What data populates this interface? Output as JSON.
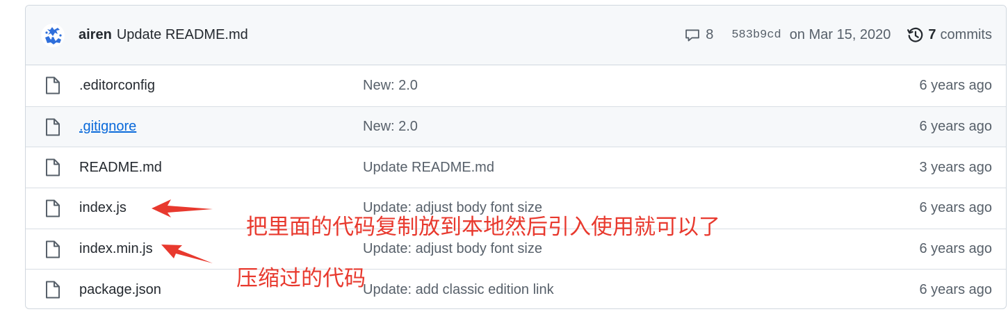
{
  "commit_bar": {
    "author": "airen",
    "message": "Update README.md",
    "comments_count": "8",
    "sha": "583b9cd",
    "date": "on Mar 15, 2020",
    "commits_count": "7",
    "commits_label": "commits"
  },
  "files": [
    {
      "name": ".editorconfig",
      "commit": "New: 2.0",
      "age": "6 years ago"
    },
    {
      "name": ".gitignore",
      "commit": "New: 2.0",
      "age": "6 years ago"
    },
    {
      "name": "README.md",
      "commit": "Update README.md",
      "age": "3 years ago"
    },
    {
      "name": "index.js",
      "commit": "Update: adjust body font size",
      "age": "6 years ago"
    },
    {
      "name": "index.min.js",
      "commit": "Update: adjust body font size",
      "age": "6 years ago"
    },
    {
      "name": "package.json",
      "commit": "Update: add classic edition link",
      "age": "6 years ago"
    }
  ],
  "annotations": {
    "copy_note": "把里面的代码复制放到本地然后引入使用就可以了",
    "minified_note": "压缩过的代码"
  },
  "colors": {
    "annotation": "#e8392e",
    "link": "#0969da",
    "avatar": "#2f6fdb"
  }
}
